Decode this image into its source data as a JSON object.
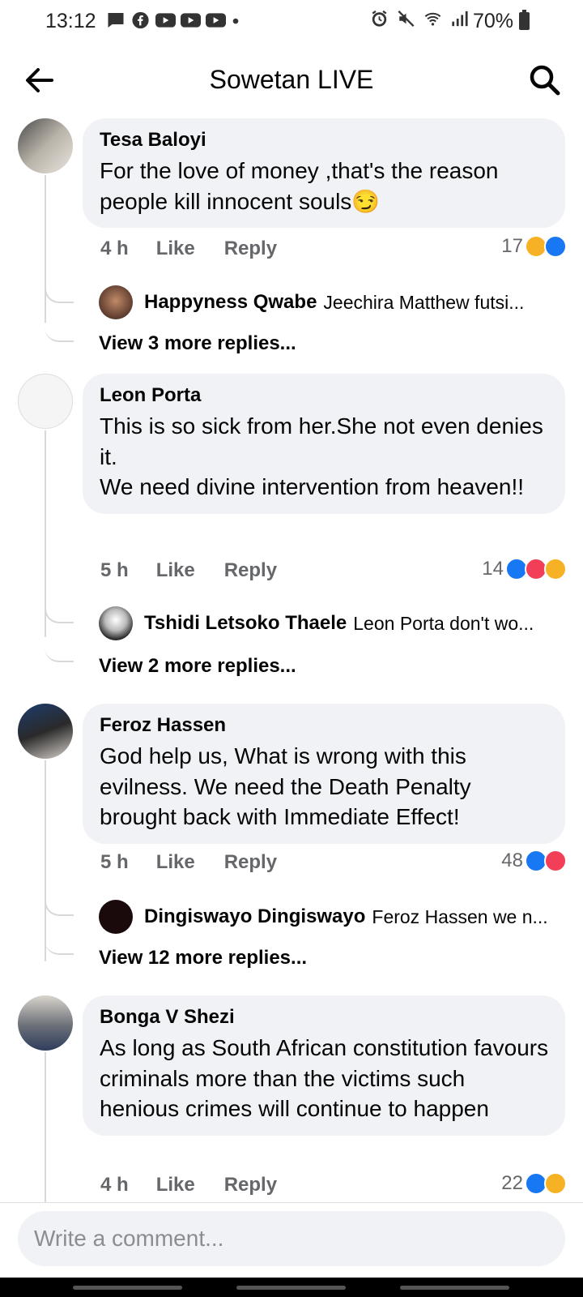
{
  "status_bar": {
    "time": "13:12",
    "battery": "70%",
    "left_icons": [
      "chat-icon",
      "facebook-icon",
      "youtube-icon",
      "youtube-icon",
      "youtube-icon",
      "dot-icon"
    ],
    "right_icons": [
      "alarm-icon",
      "mute-icon",
      "wifi-icon",
      "signal-icon"
    ]
  },
  "header": {
    "title": "Sowetan LIVE",
    "back_icon": "arrow-left-icon",
    "search_icon": "search-icon"
  },
  "comments": [
    {
      "author": "Tesa Baloyi",
      "text": "For the love of money ,that's the reason people kill innocent souls😏",
      "time": "4 h",
      "like_label": "Like",
      "reply_label": "Reply",
      "reaction_count": "17",
      "reactions": [
        "sad",
        "like"
      ],
      "reply": {
        "author": "Happyness Qwabe",
        "snippet": "Jeechira Matthew futsi..."
      },
      "view_more": "View 3 more replies..."
    },
    {
      "author": "Leon Porta",
      "text": "This is so sick from her.She not even denies it.\nWe need divine intervention from heaven!!",
      "time": "5 h",
      "like_label": "Like",
      "reply_label": "Reply",
      "reaction_count": "14",
      "reactions": [
        "like",
        "love",
        "sad"
      ],
      "reply": {
        "author": "Tshidi Letsoko Thaele",
        "snippet": "Leon Porta don't wo..."
      },
      "view_more": "View 2 more replies..."
    },
    {
      "author": "Feroz Hassen",
      "text": "God help us, What is wrong with this evilness. We need the Death Penalty brought back with Immediate Effect!",
      "time": "5 h",
      "like_label": "Like",
      "reply_label": "Reply",
      "reaction_count": "48",
      "reactions": [
        "like",
        "love"
      ],
      "reply": {
        "author": "Dingiswayo Dingiswayo",
        "snippet": "Feroz Hassen we n..."
      },
      "view_more": "View 12 more replies..."
    },
    {
      "author": "Bonga V Shezi",
      "text": "As long as South African constitution favours criminals more than the victims such henious crimes will continue to happen",
      "time": "4 h",
      "like_label": "Like",
      "reply_label": "Reply",
      "reaction_count": "22",
      "reactions": [
        "like",
        "sad"
      ]
    }
  ],
  "composer": {
    "placeholder": "Write a comment..."
  }
}
